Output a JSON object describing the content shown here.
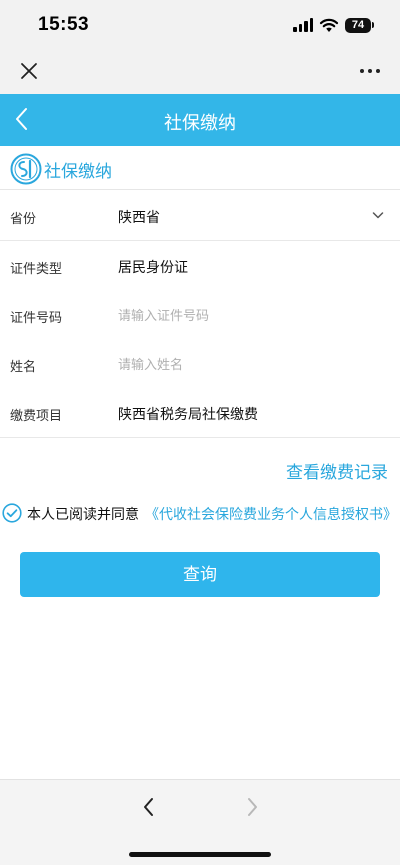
{
  "status": {
    "time": "15:53",
    "battery": "74"
  },
  "header": {
    "title": "社保缴纳"
  },
  "logo": {
    "text": "社保缴纳"
  },
  "form": {
    "province": {
      "label": "省份",
      "value": "陕西省"
    },
    "id_type": {
      "label": "证件类型",
      "value": "居民身份证"
    },
    "id_number": {
      "label": "证件号码",
      "value": "",
      "placeholder": "请输入证件号码"
    },
    "name": {
      "label": "姓名",
      "value": "",
      "placeholder": "请输入姓名"
    },
    "fee_item": {
      "label": "缴费项目",
      "value": "陕西省税务局社保缴费"
    }
  },
  "history_link": "查看缴费记录",
  "agreement": {
    "checked": true,
    "prefix": "本人已阅读并同意",
    "link": "《代收社会保险费业务个人信息授权书》"
  },
  "query_button": "查询",
  "colors": {
    "accent": "#33b6e8",
    "link": "#2aa7dd",
    "button": "#2fb5ec"
  },
  "icons": {
    "close": "close-icon",
    "more": "more-icon",
    "back": "chevron-left-icon",
    "logo": "social-security-logo-icon",
    "dropdown": "chevron-down-icon",
    "check": "check-circle-icon",
    "nav_back": "nav-back-icon",
    "nav_forward": "nav-forward-icon"
  }
}
